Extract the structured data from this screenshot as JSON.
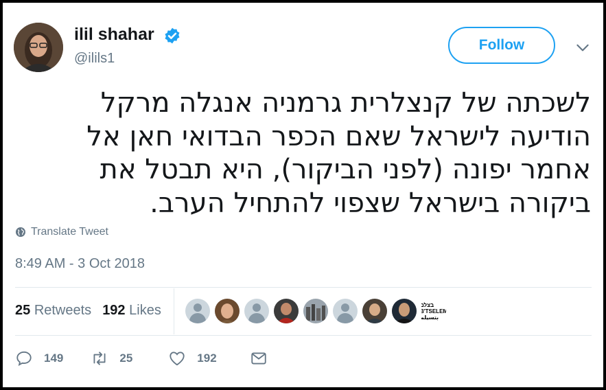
{
  "tweet": {
    "author": {
      "display_name": "ilil shahar",
      "handle": "@ilils1",
      "verified_icon": "verified-badge-icon"
    },
    "follow_label": "Follow",
    "menu_icon": "chevron-down-icon",
    "text": "לשכתה של קנצלרית גרמניה אנגלה מרקל\nהודיעה לישראל שאם הכפר הבדואי חאן אל\nאחמר יפונה (לפני הביקור), היא תבטל את\nביקורה בישראל שצפוי להתחיל הערב.",
    "translate_label": "Translate Tweet",
    "timestamp": "8:49 AM - 3 Oct 2018",
    "stats": {
      "retweets_count": "25",
      "retweets_label": "Retweets",
      "likes_count": "192",
      "likes_label": "Likes"
    },
    "liker_logo_text": "בצלם\nB'TSELEM\nبتسيلم",
    "actions": {
      "reply_count": "149",
      "retweet_count": "25",
      "like_count": "192"
    },
    "colors": {
      "accent": "#1da1f2",
      "secondary_text": "#657786",
      "primary_text": "#14171a"
    }
  }
}
